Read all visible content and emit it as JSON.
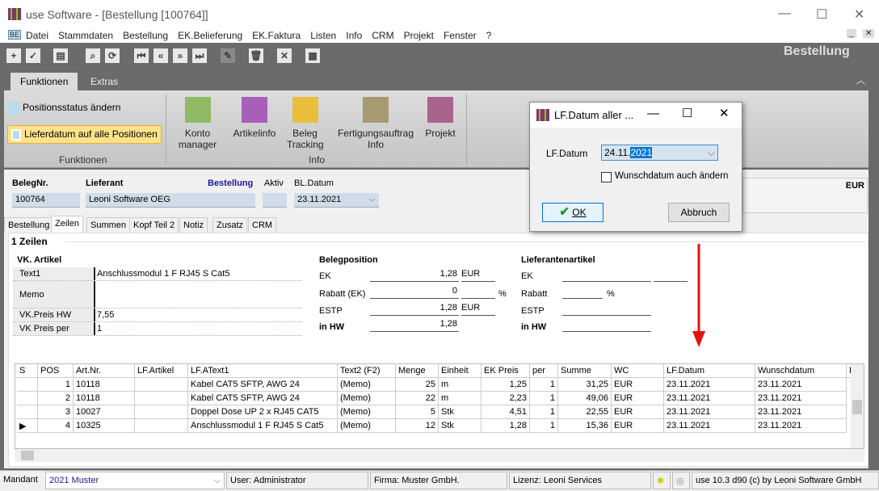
{
  "window": {
    "title": "use Software - [Bestellung [100764]]",
    "minimize": "—",
    "maximize": "☐",
    "close": "✕"
  },
  "menu": {
    "app_badge": "BE",
    "items": [
      "Datei",
      "Stammdaten",
      "Bestellung",
      "EK.Belieferung",
      "EK.Faktura",
      "Listen",
      "Info",
      "CRM",
      "Projekt",
      "Fenster",
      "?"
    ]
  },
  "toolbar": {
    "module_title": "Bestellung",
    "buttons": [
      "add-icon",
      "check-icon",
      "print-icon",
      "search-icon",
      "refresh-icon",
      "first-icon",
      "prev-icon",
      "next-icon",
      "last-icon",
      "edit-icon",
      "delete-icon",
      "cancel-icon",
      "grid-icon"
    ]
  },
  "ribbon": {
    "tabs": [
      "Funktionen",
      "Extras"
    ],
    "funktionen": {
      "items": [
        "Positionsstatus ändern",
        "Lieferdatum auf alle Positionen"
      ],
      "group": "Funktionen"
    },
    "info": {
      "items": [
        {
          "label": "Konto manager",
          "color": "#8fba63"
        },
        {
          "label": "Artikelinfo",
          "color": "#a760b8"
        },
        {
          "label": "Beleg Tracking",
          "color": "#e8be3c"
        },
        {
          "label": "Fertigungsauftrag Info",
          "color": "#a89a70"
        },
        {
          "label": "Projekt",
          "color": "#a8648c"
        }
      ],
      "group": "Info"
    }
  },
  "header": {
    "belegnr_label": "BelegNr.",
    "belegnr": "100764",
    "lieferant_label": "Lieferant",
    "lieferant": "Leoni Software OEG",
    "doc_type": "Bestellung",
    "aktiv_label": "Aktiv",
    "bldatum_label": "BL.Datum",
    "bldatum": "23.11.2021",
    "currency": "EUR"
  },
  "tabs": [
    "Bestellung",
    "Zeilen",
    "Summen",
    "Kopf Teil 2",
    "Notiz",
    "Zusatz",
    "CRM"
  ],
  "zeilen": {
    "title": "1 Zeilen",
    "vk": {
      "title": "VK. Artikel",
      "rows": [
        [
          "Text1",
          "Anschlussmodul 1 F RJ45 S Cat5"
        ],
        [
          "Memo",
          ""
        ],
        [
          "VK.Preis HW",
          "7,55"
        ],
        [
          "VK Preis per",
          "1"
        ]
      ]
    },
    "beleg": {
      "title": "Belegposition",
      "ek_label": "EK",
      "ek": "1,28",
      "ek_cur": "EUR",
      "rabatt_label": "Rabatt (EK)",
      "rabatt": "0",
      "pct": "%",
      "estp_label": "ESTP",
      "estp": "1,28",
      "estp_cur": "EUR",
      "hw_label": "in HW",
      "hw": "1,28"
    },
    "lief": {
      "title": "Lieferantenartikel",
      "ek_label": "EK",
      "rabatt_label": "Rabatt",
      "pct": "%",
      "estp_label": "ESTP",
      "hw_label": "in HW"
    }
  },
  "grid": {
    "columns": [
      "S",
      "POS",
      "Art.Nr.",
      "LF.Artikel",
      "LF.AText1",
      "Text2 (F2)",
      "Menge",
      "Einheit",
      "EK Preis",
      "per",
      "Summe",
      "WC",
      "LF.Datum",
      "Wunschdatum",
      "F"
    ],
    "rows": [
      [
        "",
        "1",
        "10118",
        "",
        "Kabel CAT5 SFTP, AWG 24",
        "(Memo)",
        "25",
        "m",
        "1,25",
        "1",
        "31,25",
        "EUR",
        "23.11.2021",
        "23.11.2021"
      ],
      [
        "",
        "2",
        "10118",
        "",
        "Kabel CAT5 SFTP, AWG 24",
        "(Memo)",
        "22",
        "m",
        "2,23",
        "1",
        "49,06",
        "EUR",
        "23.11.2021",
        "23.11.2021"
      ],
      [
        "",
        "3",
        "10027",
        "",
        "Doppel Dose UP 2 x RJ45 CAT5",
        "(Memo)",
        "5",
        "Stk",
        "4,51",
        "1",
        "22,55",
        "EUR",
        "23.11.2021",
        "23.11.2021"
      ],
      [
        "▶",
        "4",
        "10325",
        "",
        "Anschlussmodul 1 F RJ45 S Cat5",
        "(Memo)",
        "12",
        "Stk",
        "1,28",
        "1",
        "15,36",
        "EUR",
        "23.11.2021",
        "23.11.2021"
      ]
    ],
    "current_row": 4
  },
  "dialog": {
    "title": "LF.Datum aller ...",
    "field_label": "LF.Datum",
    "date_prefix": "24.11.",
    "date_selected": "2021",
    "checkbox_label": "Wunschdatum auch ändern",
    "checkbox_checked": false,
    "ok": "OK",
    "cancel": "Abbruch"
  },
  "status": {
    "mandant_label": "Mandant",
    "mandant": "2021 Muster",
    "user": "User: Administrator",
    "firma": "Firma: Muster GmbH.",
    "lizenz": "Lizenz: Leoni Services",
    "version": "use 10.3 d90 (c) by Leoni Software GmbH"
  },
  "annotation": {
    "arrow_color": "#e81010"
  }
}
